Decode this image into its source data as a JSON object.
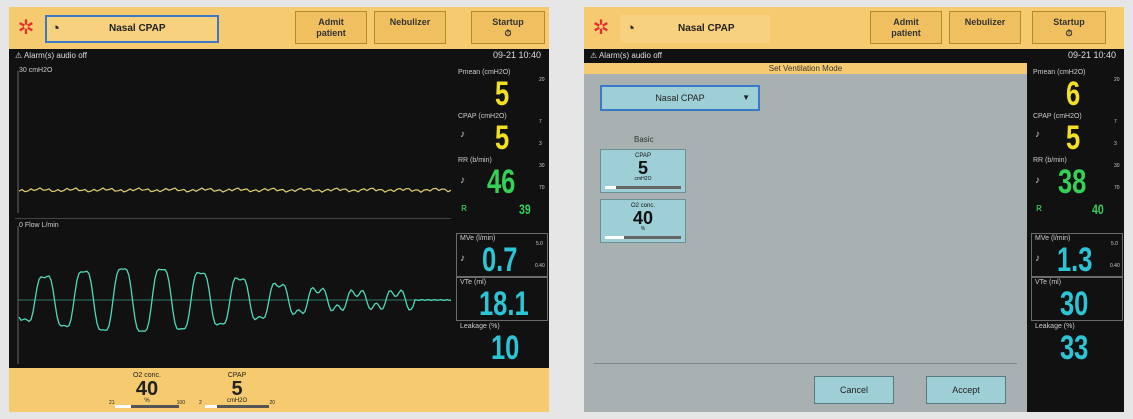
{
  "left_screen": {
    "mode_label": "Nasal CPAP",
    "buttons": [
      "Admit\npatient",
      "Nebulizer",
      "Startup\n⏱"
    ],
    "alarm_text": "⚠ Alarm(s) audio off",
    "datetime": "09-21  10:40",
    "waveform1_label": "30  cmH2O",
    "waveform2_label": "0   Flow  L/min",
    "params": {
      "pmean": {
        "label": "Pmean  (cmH2O)",
        "value": "5",
        "range_hi": "20"
      },
      "cpap": {
        "label": "CPAP  (cmH2O)",
        "value": "5",
        "range_hi": "7",
        "range_lo": "3"
      },
      "rr": {
        "label": "RR  (b/min)",
        "value": "46",
        "range_hi": "30",
        "range_lo": "70",
        "apnea": "39"
      },
      "mve": {
        "label": "MVe  (l/min)",
        "value": "0.7",
        "range_hi": "5.0",
        "range_lo": "0.40"
      },
      "vte": {
        "label": "VTe  (ml)",
        "value": "18.1"
      },
      "leakage": {
        "label": "Leakage  (%)",
        "value": "10"
      }
    },
    "bottom": [
      {
        "title": "O2 conc.",
        "value": "40",
        "unit": "%",
        "lo": "21",
        "hi": "100",
        "fill": 0.25
      },
      {
        "title": "CPAP",
        "value": "5",
        "unit": "cmH2O",
        "lo": "2",
        "hi": "20",
        "fill": 0.18
      }
    ],
    "colors": {
      "pressure_wave": "#e2d070",
      "flow_wave": "#4fd8b8",
      "yellow_value": "#f3e020",
      "green_value": "#34d057",
      "cyan_value": "#2cc5d6"
    }
  },
  "right_screen": {
    "mode_label": "Nasal CPAP",
    "buttons": [
      "Admit\npatient",
      "Nebulizer",
      "Startup\n⏱"
    ],
    "alarm_text": "⚠ Alarm(s) audio off",
    "datetime": "09-21  10:40",
    "dialog_title": "Set Ventilation Mode",
    "dropdown_value": "Nasal CPAP",
    "basic_label": "Basic",
    "cards": [
      {
        "title": "CPAP",
        "value": "5",
        "unit": "cmH2O",
        "fill": 0.15
      },
      {
        "title": "O2 conc.",
        "value": "40",
        "unit": "%",
        "fill": 0.25
      }
    ],
    "cancel_label": "Cancel",
    "accept_label": "Accept",
    "params": {
      "pmean": {
        "label": "Pmean  (cmH2O)",
        "value": "6",
        "range_hi": "20"
      },
      "cpap": {
        "label": "CPAP  (cmH2O)",
        "value": "5",
        "range_hi": "7",
        "range_lo": "3"
      },
      "rr": {
        "label": "RR  (b/min)",
        "value": "38",
        "range_hi": "30",
        "range_lo": "70",
        "apnea": "40"
      },
      "mve": {
        "label": "MVe  (l/min)",
        "value": "1.3",
        "range_hi": "5.0",
        "range_lo": "0.40"
      },
      "vte": {
        "label": "VTe  (ml)",
        "value": "30"
      },
      "leakage": {
        "label": "Leakage  (%)",
        "value": "33"
      }
    }
  }
}
